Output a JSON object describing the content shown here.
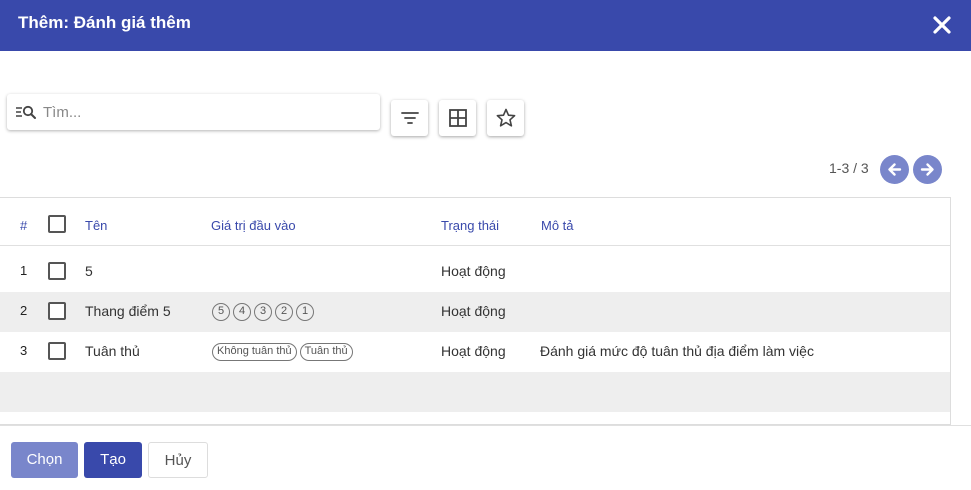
{
  "dialog": {
    "title": "Thêm: Đánh giá thêm"
  },
  "search": {
    "placeholder": "Tìm..."
  },
  "pager": {
    "text": "1-3 / 3"
  },
  "table": {
    "headers": {
      "num": "#",
      "name": "Tên",
      "inputs": "Giá trị đầu vào",
      "status": "Trạng thái",
      "desc": "Mô tả"
    },
    "rows": [
      {
        "num": "1",
        "name": "5",
        "tags": [],
        "status": "Hoạt động",
        "desc": ""
      },
      {
        "num": "2",
        "name": "Thang điểm 5",
        "tags": [
          "5",
          "4",
          "3",
          "2",
          "1"
        ],
        "status": "Hoạt động",
        "desc": ""
      },
      {
        "num": "3",
        "name": "Tuân thủ",
        "tags": [
          "Không tuân thủ",
          "Tuân thủ"
        ],
        "status": "Hoạt động",
        "desc": "Đánh giá mức độ tuân thủ địa điểm làm việc"
      }
    ]
  },
  "footer": {
    "select_label": "Chọn",
    "create_label": "Tạo",
    "cancel_label": "Hủy"
  },
  "colors": {
    "primary": "#3949ab",
    "primary_light": "#7986cb"
  },
  "icons": [
    "close-icon",
    "search-icon",
    "filter-icon",
    "grid-icon",
    "star-icon",
    "arrow-left-icon",
    "arrow-right-icon"
  ]
}
